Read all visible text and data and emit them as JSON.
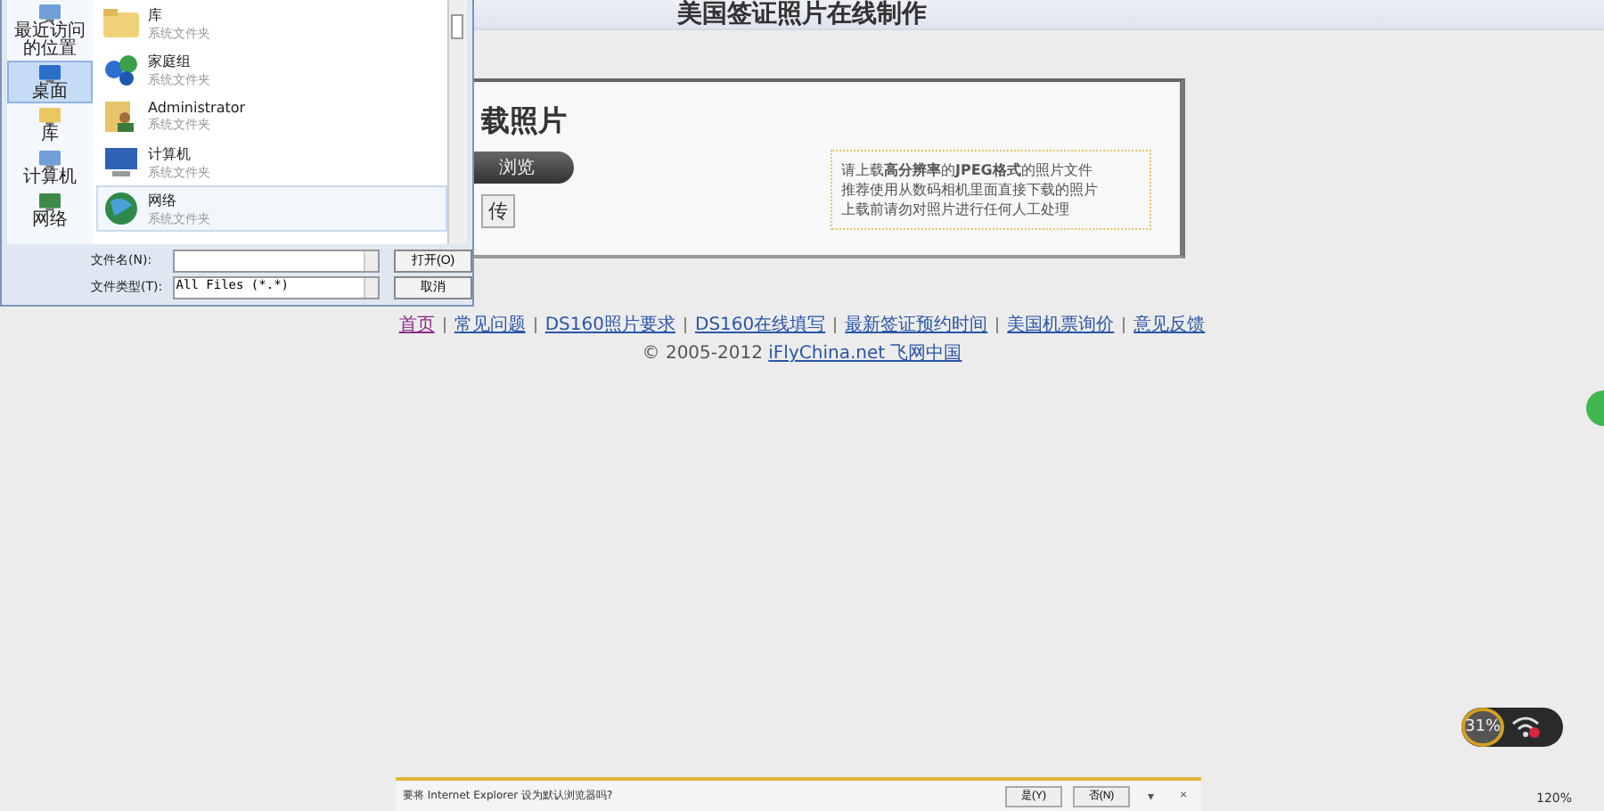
{
  "page": {
    "title": "美国签证照片在线制作",
    "heading": "载照片",
    "browse_button": "浏览",
    "upload_button": "传",
    "notice": [
      "请上载**高分辨率**的**JPEG格式**的照片文件",
      "推荐使用从数码相机里面直接下载的照片",
      "上载前请勿对照片进行任何人工处理"
    ],
    "footer_links": [
      {
        "label": "首页",
        "visited": true
      },
      {
        "label": "常见问题",
        "visited": false
      },
      {
        "label": "DS160照片要求",
        "visited": false
      },
      {
        "label": "DS160在线填写",
        "visited": false
      },
      {
        "label": "最新签证预约时间",
        "visited": false
      },
      {
        "label": "美国机票询价",
        "visited": false
      },
      {
        "label": "意见反馈",
        "visited": false
      }
    ],
    "copyright": "© 2005-2012",
    "copyright_link": "iFlyChina.net 飞网中国"
  },
  "file_dialog": {
    "places": [
      {
        "label": "最近访问的位置",
        "selected": false
      },
      {
        "label": "桌面",
        "selected": true
      },
      {
        "label": "库",
        "selected": false
      },
      {
        "label": "计算机",
        "selected": false
      },
      {
        "label": "网络",
        "selected": false
      }
    ],
    "items": [
      {
        "name": "库",
        "type": "系统文件夹",
        "hovered": false
      },
      {
        "name": "家庭组",
        "type": "系统文件夹",
        "hovered": false
      },
      {
        "name": "Administrator",
        "type": "系统文件夹",
        "hovered": false
      },
      {
        "name": "计算机",
        "type": "系统文件夹",
        "hovered": false
      },
      {
        "name": "网络",
        "type": "系统文件夹",
        "hovered": true
      }
    ],
    "filename_label": "文件名(N):",
    "filetype_label": "文件类型(T):",
    "filetype_value": "All Files (*.*)",
    "open_button": "打开(O)",
    "cancel_button": "取消"
  },
  "widget": {
    "value": "31%"
  },
  "notification": {
    "text": "要将 Internet Explorer 设为默认浏览器吗?",
    "yes": "是(Y)",
    "no": "否(N)",
    "more": "▾",
    "close": "×"
  },
  "status_bar": {
    "zoom": "120%"
  }
}
